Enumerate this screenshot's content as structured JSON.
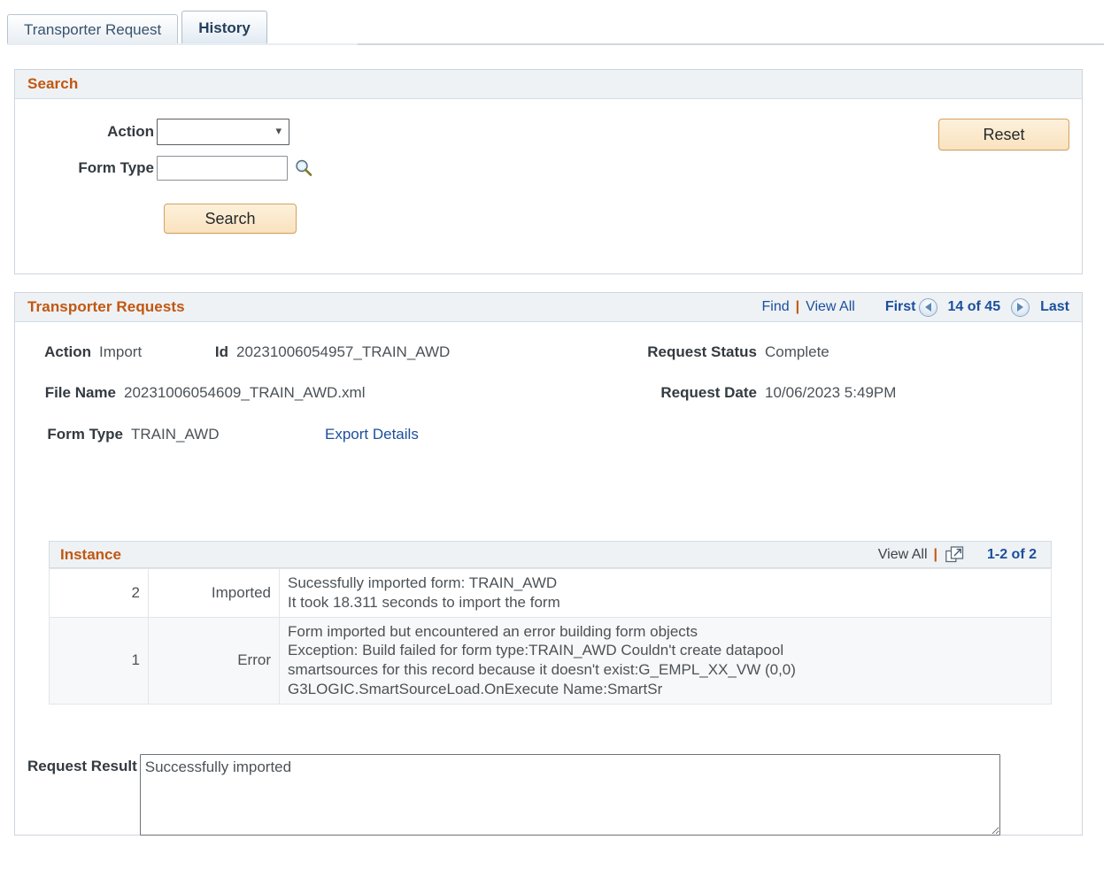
{
  "tabs": [
    {
      "label": "Transporter Request",
      "active": false
    },
    {
      "label": "History",
      "active": true
    }
  ],
  "search_panel": {
    "title": "Search",
    "action_label": "Action",
    "action_value": "",
    "action_options": [
      ""
    ],
    "form_type_label": "Form Type",
    "form_type_value": "",
    "lookup_icon": "search-icon",
    "search_button": "Search",
    "reset_button": "Reset"
  },
  "requests_panel": {
    "title": "Transporter Requests",
    "find_label": "Find",
    "view_all_label": "View All",
    "first_label": "First",
    "last_label": "Last",
    "counter": "14 of 45",
    "prev_icon": "prev-arrow-icon",
    "next_icon": "next-arrow-icon",
    "fields": {
      "action_label": "Action",
      "action_value": "Import",
      "id_label": "Id",
      "id_value": "20231006054957_TRAIN_AWD",
      "request_status_label": "Request Status",
      "request_status_value": "Complete",
      "file_name_label": "File Name",
      "file_name_value": "20231006054609_TRAIN_AWD.xml",
      "request_date_label": "Request Date",
      "request_date_value": "10/06/2023  5:49PM",
      "form_type_label": "Form Type",
      "form_type_value": "TRAIN_AWD",
      "export_details_link": "Export Details"
    },
    "instance_grid": {
      "title": "Instance",
      "view_all_label": "View All",
      "expand_icon": "expand-grid-icon",
      "range_label": "1-2 of 2",
      "rows": [
        {
          "instance": "2",
          "status": "Imported",
          "message": "Sucessfully imported form: TRAIN_AWD\nIt took 18.311 seconds to import the form"
        },
        {
          "instance": "1",
          "status": "Error",
          "message": "Form imported but encountered an error building form objects\nException: Build failed for form type:TRAIN_AWD Couldn't create datapool\nsmartsources for this record because it doesn't exist:G_EMPL_XX_VW (0,0)\nG3LOGIC.SmartSourceLoad.OnExecute  Name:SmartSr"
        }
      ]
    },
    "request_result_label": "Request Result",
    "request_result_value": "Successfully imported"
  },
  "colors": {
    "header_orange": "#c2570f",
    "link_blue": "#1c4f9c",
    "panel_header_bg": "#eef2f5",
    "button_gold": "#f9e2bf",
    "border_gray": "#cdd5dd"
  }
}
